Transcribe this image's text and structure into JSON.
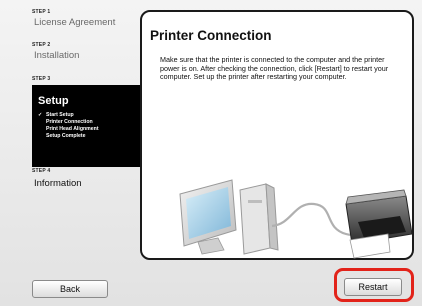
{
  "sidebar": {
    "steps": [
      {
        "tag": "STEP 1",
        "name": "License Agreement"
      },
      {
        "tag": "STEP 2",
        "name": "Installation"
      },
      {
        "tag": "STEP 3",
        "name": "Setup"
      },
      {
        "tag": "STEP 4",
        "name": "Information"
      }
    ],
    "substeps": [
      {
        "check": "✓",
        "label": "Start Setup"
      },
      {
        "check": "",
        "label": "Printer Connection"
      },
      {
        "check": "",
        "label": "Print Head Alignment"
      },
      {
        "check": "",
        "label": "Setup Complete"
      }
    ]
  },
  "main": {
    "title": "Printer Connection",
    "body": "Make sure that the printer is connected to the computer and the printer power is on. After checking the connection, click [Restart] to restart your computer. Set up the printer after restarting your computer."
  },
  "buttons": {
    "back": "Back",
    "restart": "Restart"
  },
  "colors": {
    "highlight": "#e2231a",
    "current_step_bg": "#000000"
  },
  "illustration": {
    "items": [
      "monitor-icon",
      "computer-tower-icon",
      "usb-cable-icon",
      "printer-icon"
    ]
  }
}
